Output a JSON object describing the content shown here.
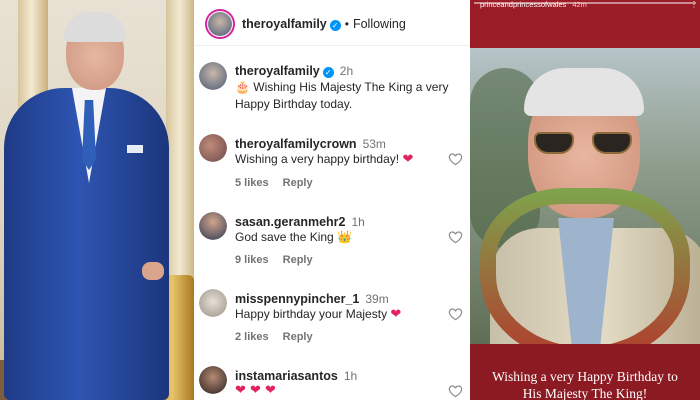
{
  "post": {
    "author": "theroyalfamily",
    "follow_status": "Following",
    "caption_author": "theroyalfamily",
    "caption_time": "2h",
    "caption_emoji": "🎂",
    "caption_text": " Wishing His Majesty The King a very Happy Birthday today."
  },
  "comments": [
    {
      "username": "theroyalfamilycrown",
      "time": "53m",
      "text": "Wishing a very happy birthday!",
      "emoji": "❤",
      "likes": "5 likes",
      "reply": "Reply",
      "avatar_color": "#7a5c5a"
    },
    {
      "username": "sasan.geranmehr2",
      "time": "1h",
      "text": "God save the King",
      "emoji": "👑",
      "likes": "9 likes",
      "reply": "Reply",
      "avatar_color": "#3c4a5e"
    },
    {
      "username": "misspennypincher_1",
      "time": "39m",
      "text": "Happy birthday your Majesty",
      "emoji": "❤",
      "likes": "2 likes",
      "reply": "Reply",
      "avatar_color": "#b9b2a7"
    },
    {
      "username": "instamariasantos",
      "time": "1h",
      "text": "",
      "emoji": "❤ ❤ ❤",
      "likes": "",
      "reply": "",
      "avatar_color": "#3a2f2c"
    }
  ],
  "story": {
    "username": "princeandprincessofwales",
    "time": "42m",
    "caption_line1": "Wishing a very Happy Birthday to",
    "caption_line2": "His Majesty The King!"
  },
  "colors": {
    "verified": "#0095f6",
    "story_bg": "#8b1a23",
    "heart": "#e0245e",
    "suit": "#2e55b2"
  }
}
